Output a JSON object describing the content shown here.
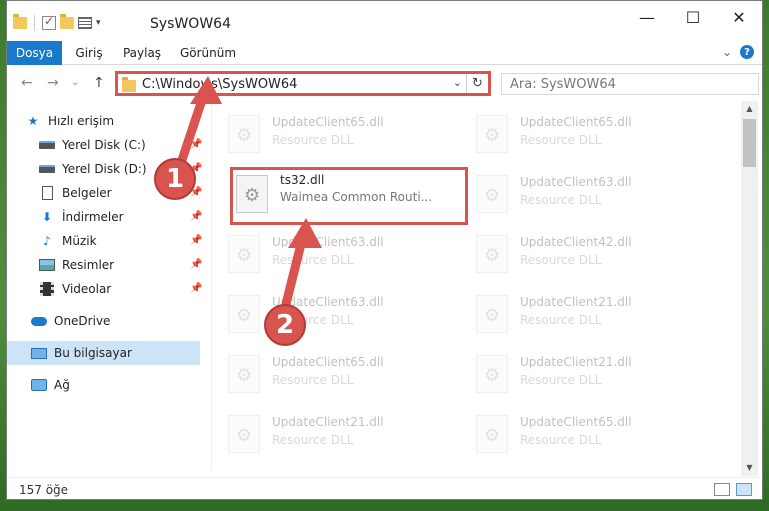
{
  "window": {
    "title": "SysWOW64",
    "minimize_label": "—",
    "maximize_label": "☐",
    "close_label": "✕"
  },
  "ribbon": {
    "tabs": [
      {
        "label": "Dosya",
        "active": true
      },
      {
        "label": "Giriş",
        "active": false
      },
      {
        "label": "Paylaş",
        "active": false
      },
      {
        "label": "Görünüm",
        "active": false
      }
    ],
    "collapse_glyph": "⌄",
    "help_glyph": "?"
  },
  "address": {
    "back_glyph": "←",
    "forward_glyph": "→",
    "recent_glyph": "⌄",
    "up_glyph": "↑",
    "path": "C:\\Windows\\SysWOW64",
    "dropdown_glyph": "⌄",
    "refresh_glyph": "↻",
    "search_placeholder": "Ara: SysWOW64"
  },
  "sidebar": {
    "items": [
      {
        "label": "Hızlı erişim",
        "icon": "star-icon"
      },
      {
        "label": "Yerel Disk (C:)",
        "icon": "drive-icon"
      },
      {
        "label": "Yerel Disk (D:)",
        "icon": "drive-icon"
      },
      {
        "label": "Belgeler",
        "icon": "document-icon"
      },
      {
        "label": "İndirmeler",
        "icon": "download-icon"
      },
      {
        "label": "Müzik",
        "icon": "music-icon"
      },
      {
        "label": "Resimler",
        "icon": "pictures-icon"
      },
      {
        "label": "Videolar",
        "icon": "video-icon"
      },
      {
        "label": "OneDrive",
        "icon": "cloud-icon"
      },
      {
        "label": "Bu bilgisayar",
        "icon": "computer-icon"
      },
      {
        "label": "Ağ",
        "icon": "network-icon"
      }
    ],
    "pin_glyph": "📌"
  },
  "files": [
    {
      "name": "UpdateClient65.dll",
      "desc": "Resource DLL"
    },
    {
      "name": "UpdateClient65.dll",
      "desc": "Resource DLL"
    },
    {
      "name": "ts32.dll",
      "desc": "Waimea Common Routi..."
    },
    {
      "name": "UpdateClient63.dll",
      "desc": "Resource DLL"
    },
    {
      "name": "UpdateClient63.dll",
      "desc": "Resource DLL"
    },
    {
      "name": "UpdateClient42.dll",
      "desc": "Resource DLL"
    },
    {
      "name": "UpdateClient63.dll",
      "desc": "Resource DLL"
    },
    {
      "name": "UpdateClient21.dll",
      "desc": "Resource DLL"
    },
    {
      "name": "UpdateClient65.dll",
      "desc": "Resource DLL"
    },
    {
      "name": "UpdateClient21.dll",
      "desc": "Resource DLL"
    },
    {
      "name": "UpdateClient21.dll",
      "desc": "Resource DLL"
    },
    {
      "name": "UpdateClient65.dll",
      "desc": "Resource DLL"
    }
  ],
  "scrollbar": {
    "up_glyph": "▲",
    "down_glyph": "▼"
  },
  "status": {
    "count": "157 öğe"
  },
  "annotations": {
    "step1": "1",
    "step2": "2",
    "color": "#d9534f"
  }
}
